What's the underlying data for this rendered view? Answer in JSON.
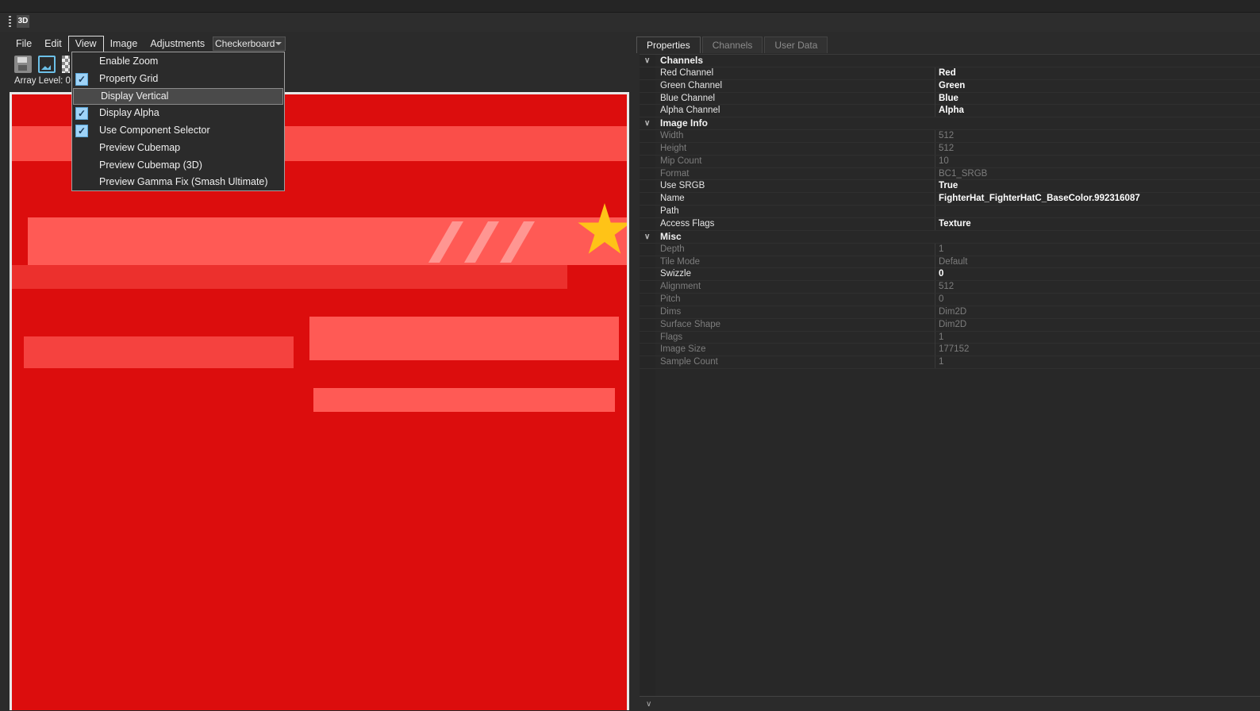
{
  "window": {
    "doc_icon_text": "3D"
  },
  "menubar": {
    "items": [
      "File",
      "Edit",
      "View",
      "Image",
      "Adjustments"
    ],
    "active": "View",
    "background_combo": {
      "value": "Checkerboard"
    }
  },
  "toolbar": {
    "array_level_label": "Array Level: 0 /"
  },
  "view_menu": {
    "items": [
      {
        "label": "Enable Zoom",
        "checked": false
      },
      {
        "label": "Property Grid",
        "checked": true
      },
      {
        "label": "Display Vertical",
        "checked": false,
        "hovered": true
      },
      {
        "label": "Display Alpha",
        "checked": true
      },
      {
        "label": "Use Component Selector",
        "checked": true
      },
      {
        "label": "Preview Cubemap",
        "checked": false
      },
      {
        "label": "Preview Cubemap (3D)",
        "checked": false
      },
      {
        "label": "Preview Gamma Fix (Smash Ultimate)",
        "checked": false
      }
    ]
  },
  "tabs": [
    {
      "label": "Properties",
      "active": true
    },
    {
      "label": "Channels",
      "active": false
    },
    {
      "label": "User Data",
      "active": false
    }
  ],
  "properties": {
    "channels": {
      "title": "Channels",
      "rows": [
        {
          "name": "Red Channel",
          "value": "Red",
          "dim": false
        },
        {
          "name": "Green Channel",
          "value": "Green",
          "dim": false
        },
        {
          "name": "Blue Channel",
          "value": "Blue",
          "dim": false
        },
        {
          "name": "Alpha Channel",
          "value": "Alpha",
          "dim": false
        }
      ]
    },
    "image_info": {
      "title": "Image Info",
      "rows": [
        {
          "name": "Width",
          "value": "512",
          "dim": true
        },
        {
          "name": "Height",
          "value": "512",
          "dim": true
        },
        {
          "name": "Mip Count",
          "value": "10",
          "dim": true
        },
        {
          "name": "Format",
          "value": "BC1_SRGB",
          "dim": true
        },
        {
          "name": "Use SRGB",
          "value": "True",
          "dim": false
        },
        {
          "name": "Name",
          "value": "FighterHat_FighterHatC_BaseColor.992316087",
          "dim": false
        },
        {
          "name": "Path",
          "value": "",
          "dim": false
        },
        {
          "name": "Access Flags",
          "value": "Texture",
          "dim": false
        }
      ]
    },
    "misc": {
      "title": "Misc",
      "rows": [
        {
          "name": "Depth",
          "value": "1",
          "dim": true
        },
        {
          "name": "Tile Mode",
          "value": "Default",
          "dim": true
        },
        {
          "name": "Swizzle",
          "value": "0",
          "dim": false
        },
        {
          "name": "Alignment",
          "value": "512",
          "dim": true
        },
        {
          "name": "Pitch",
          "value": "0",
          "dim": true
        },
        {
          "name": "Dims",
          "value": "Dim2D",
          "dim": true
        },
        {
          "name": "Surface Shape",
          "value": "Dim2D",
          "dim": true
        },
        {
          "name": "Flags",
          "value": "1",
          "dim": true
        },
        {
          "name": "Image Size",
          "value": "177152",
          "dim": true
        },
        {
          "name": "Sample Count",
          "value": "1",
          "dim": true
        }
      ]
    }
  },
  "colors": {
    "texture_base": "#dc0d0d",
    "texture_highlight": "#ff5a55",
    "star": "#ffc317",
    "check_fill": "#9fd3f7"
  }
}
